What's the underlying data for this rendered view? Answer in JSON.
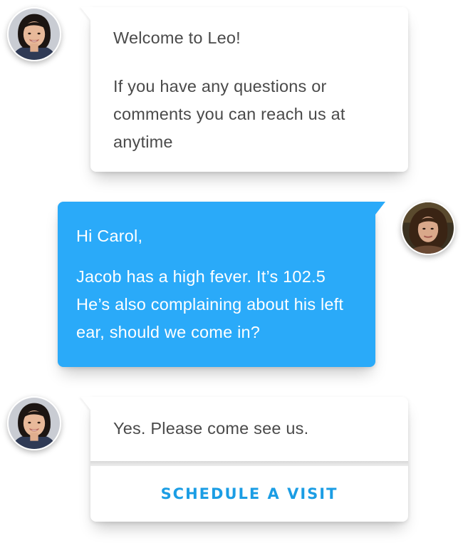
{
  "colors": {
    "outgoing_bubble": "#2aaaf9",
    "incoming_bubble": "#ffffff",
    "incoming_text": "#4a4a4a",
    "outgoing_text": "#ffffff",
    "action_text": "#1b9de4"
  },
  "messages": [
    {
      "direction": "incoming",
      "paragraphs": [
        "Welcome to Leo!",
        "If you have any questions or comments you can reach us at anytime"
      ]
    },
    {
      "direction": "outgoing",
      "paragraphs": [
        "Hi Carol,",
        "Jacob has a high fever. It’s 102.5 He’s also complaining about his left ear, should we come in?"
      ]
    },
    {
      "direction": "incoming",
      "paragraphs": [
        "Yes. Please come see us."
      ],
      "action_label": "SCHEDULE A VISIT"
    }
  ]
}
